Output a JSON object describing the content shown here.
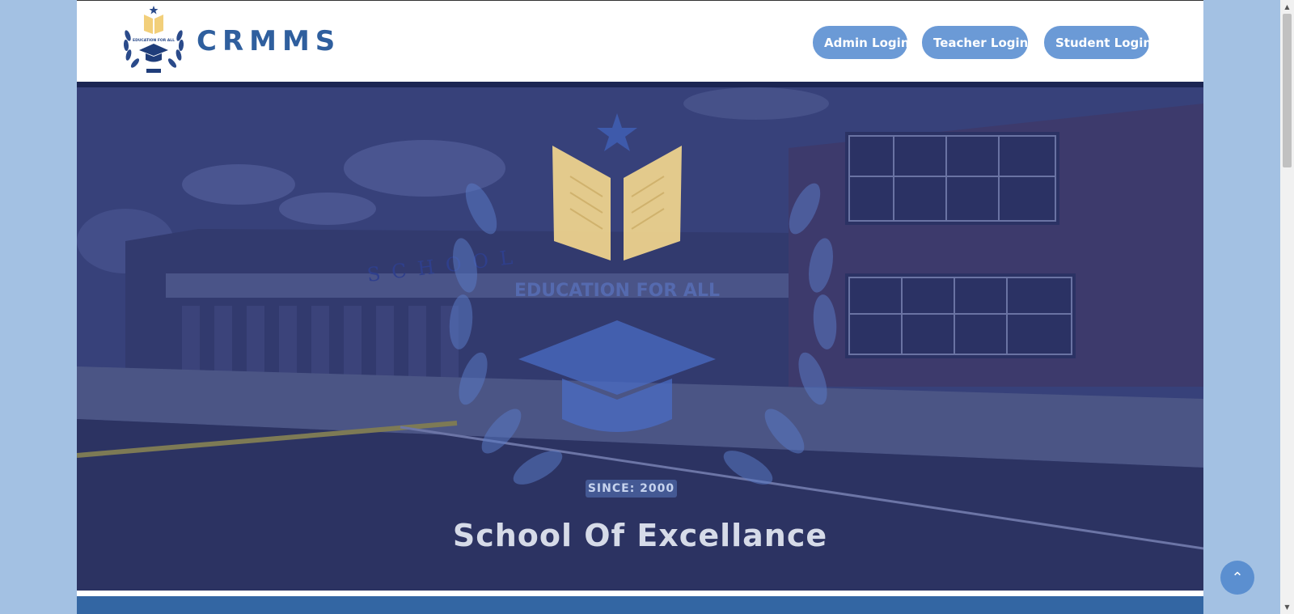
{
  "brand": {
    "name": "CRMMS",
    "emblem_text": "EDUCATION FOR ALL"
  },
  "nav": {
    "admin_login": "Admin Login",
    "teacher_login": "Teacher Login",
    "student_login": "Student Login"
  },
  "hero": {
    "emblem_text": "EDUCATION FOR ALL",
    "building_sign": "SCHOOL",
    "since_badge": "SINCE: 2000",
    "title": "School Of Excellance"
  },
  "icons": {
    "scroll_to_top": "chevron-up-icon",
    "emblem": "graduation-cap-icon"
  },
  "colors": {
    "page_background": "#a3c1e3",
    "nav_button": "#6b9ad6",
    "brand_text": "#2f5f9e",
    "hero_overlay": "#2a3368",
    "footer_band": "#3366a3"
  }
}
